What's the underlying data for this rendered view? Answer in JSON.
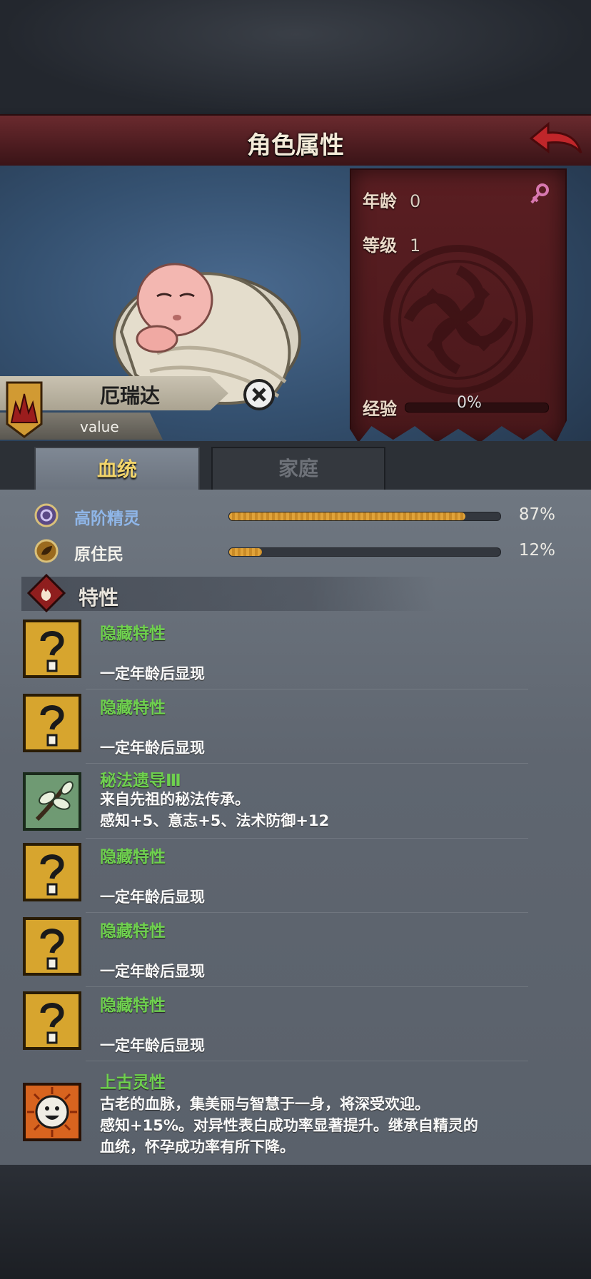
{
  "screen": {
    "title": "角色属性"
  },
  "character": {
    "name": "厄瑞达",
    "subtitle": "value",
    "age_label": "年龄",
    "age_value": "0",
    "level_label": "等级",
    "level_value": "1",
    "exp_label": "经验",
    "exp_value": "0%",
    "exp_fraction": 0,
    "gender": "female"
  },
  "tabs": [
    {
      "label": "血统",
      "active": true
    },
    {
      "label": "家庭",
      "active": false
    }
  ],
  "bloodlines": [
    {
      "name": "高阶精灵",
      "percent_text": "87%",
      "fraction": 0.87,
      "name_color": "#8fb6e8",
      "icon": "high-elf-icon"
    },
    {
      "name": "原住民",
      "percent_text": "12%",
      "fraction": 0.12,
      "name_color": "#f0efe9",
      "icon": "native-icon"
    }
  ],
  "traits_header": "特性",
  "traits": [
    {
      "name": "隐藏特性",
      "lines": [
        "",
        "一定年龄后显现"
      ],
      "icon": "question-mark-icon"
    },
    {
      "name": "隐藏特性",
      "lines": [
        "",
        "一定年龄后显现"
      ],
      "icon": "question-mark-icon"
    },
    {
      "name": "秘法遗导Ⅲ",
      "lines": [
        "来自先祖的秘法传承。",
        "感知+5、意志+5、法术防御+12"
      ],
      "icon": "branch-icon"
    },
    {
      "name": "隐藏特性",
      "lines": [
        "",
        "一定年龄后显现"
      ],
      "icon": "question-mark-icon"
    },
    {
      "name": "隐藏特性",
      "lines": [
        "",
        "一定年龄后显现"
      ],
      "icon": "question-mark-icon"
    },
    {
      "name": "隐藏特性",
      "lines": [
        "",
        "一定年龄后显现"
      ],
      "icon": "question-mark-icon"
    },
    {
      "name": "上古灵性",
      "lines": [
        "古老的血脉，集美丽与智慧于一身，将深受欢迎。",
        "感知+15%。对异性表白成功率显著提升。继承自精灵的",
        "血统，怀孕成功率有所下降。"
      ],
      "icon": "smiling-face-icon"
    }
  ],
  "colors": {
    "trait_name": "#6fd04f",
    "tab_active_text": "#f2d56b",
    "bar_fill": "#e0a33a",
    "banner": "#5a1e22"
  }
}
